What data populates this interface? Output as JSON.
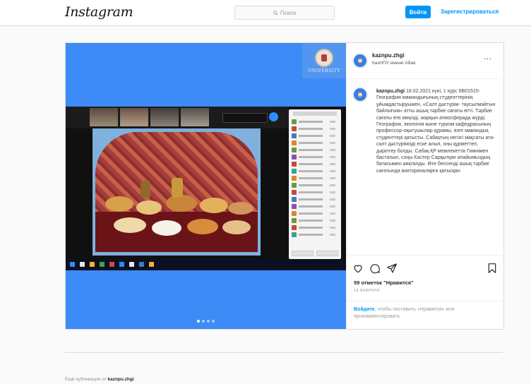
{
  "header": {
    "logo": "Instagram",
    "search_placeholder": "Поиск",
    "login_button": "Войти",
    "register_link": "Зарегистрироваться"
  },
  "post": {
    "username": "kaznpu.zhgi",
    "subtitle": "КазНПУ имени Абая",
    "more_icon": "…",
    "caption_date": "18.02.2021",
    "caption_text": "күні, 1 курс 6В01515-География мамандығының студенттерінің ұйымдастыруымен, «Салт дәстүрім- таусылмайтын байлығым» атты ашық тәрбие сағаты өтті. Тәрбие сағаты өте көңілді, жарқын атмосферада жүрді. География, экология және туризм кафедрасының профессор-оқытушылар құрамы, өзге мамандық студенттері қатысты. Сабақтың негізгі мақсаты ата-салт дәстүрімізді еске алып, оны құрметтеп, дәріптеу болды. Сабақ ҚР мемлекеттік Гимнімен басталып, соңы Кәстер Сарқытқан апайымыздың батасымен аяқталды. Өте белсенді ашық тәрбие сағатында викториналарға қатысқан",
    "likes_count": "59",
    "likes_suffix": "отметок \"Нравится\"",
    "timestamp": "18 ФЕВРАЛЯ",
    "login_prompt_link": "Войдите",
    "login_prompt_rest": ", чтобы поставить «Нравится» или прокомментировать.",
    "university_label": "UNIVERSITY"
  },
  "footer": {
    "more_from_prefix": "Ещё публикации от",
    "more_from_user": "kaznpu.zhgi"
  },
  "colors": {
    "accent": "#0095f6",
    "media_background": "#3d8bf7"
  },
  "icons": [
    "search-icon",
    "more-icon",
    "heart-icon",
    "comment-icon",
    "share-icon",
    "bookmark-icon"
  ]
}
